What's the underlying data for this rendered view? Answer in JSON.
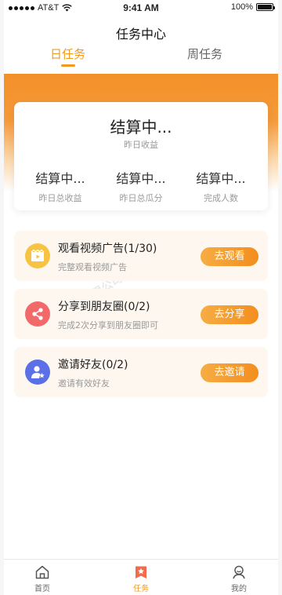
{
  "status_bar": {
    "carrier": "AT&T",
    "time": "9:41 AM",
    "battery": "100%"
  },
  "header": {
    "title": "任务中心"
  },
  "tabs": [
    {
      "label": "日任务",
      "active": true
    },
    {
      "label": "周任务",
      "active": false
    }
  ],
  "summary": {
    "main_value": "结算中...",
    "main_label": "昨日收益",
    "stats": [
      {
        "value": "结算中...",
        "label": "昨日总收益"
      },
      {
        "value": "结算中...",
        "label": "昨日总瓜分"
      },
      {
        "value": "结算中...",
        "label": "完成人数"
      }
    ]
  },
  "tasks": [
    {
      "icon": "video-icon",
      "title": "观看视频广告(1/30)",
      "desc": "完整观看视频广告",
      "button": "去观看"
    },
    {
      "icon": "share-icon",
      "title": "分享到朋友圈(0/2)",
      "desc": "完成2次分享到朋友圈即可",
      "button": "去分享"
    },
    {
      "icon": "invite-user-icon",
      "title": "邀请好友(0/2)",
      "desc": "邀请有效好友",
      "button": "去邀请"
    }
  ],
  "tabbar": [
    {
      "label": "首页",
      "icon": "home-icon",
      "active": false
    },
    {
      "label": "任务",
      "icon": "task-icon",
      "active": true
    },
    {
      "label": "我的",
      "icon": "profile-icon",
      "active": false
    }
  ],
  "colors": {
    "accent": "#f39a1e",
    "banner": "#f39028",
    "card_bg": "#fdf7ef"
  }
}
